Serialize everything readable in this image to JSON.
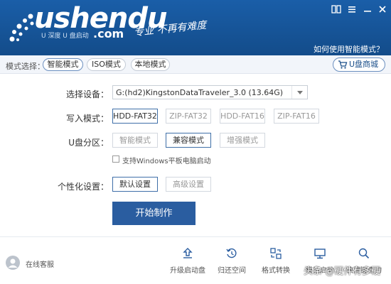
{
  "header": {
    "logo_text": "ushendu",
    "logo_sub": "U 深度 U 盘启动",
    "logo_com": ".com",
    "slogan": "专业 不再有难度",
    "help_link": "如何使用智能模式？",
    "controls": [
      "book-icon",
      "menu-icon",
      "minimize-icon",
      "close-icon"
    ]
  },
  "modebar": {
    "label": "模式选择：",
    "modes": [
      "智能模式",
      "ISO模式",
      "本地模式"
    ],
    "selected_mode": "智能模式",
    "shop": "U盘商城"
  },
  "form": {
    "device_label": "选择设备：",
    "device_value": "G:(hd2)KingstonDataTraveler_3.0 (13.64G)",
    "write_label": "写入模式：",
    "write_options": [
      "HDD-FAT32",
      "ZIP-FAT32",
      "HDD-FAT16",
      "ZIP-FAT16"
    ],
    "write_selected": "HDD-FAT32",
    "partition_label": "U盘分区：",
    "partition_options": [
      "智能模式",
      "兼容模式",
      "增强模式"
    ],
    "partition_selected": "兼容模式",
    "checkbox_label": "支持Windows平板电脑启动",
    "checkbox_checked": false,
    "personal_label": "个性化设置：",
    "personal_options": [
      "默认设置",
      "高级设置"
    ],
    "personal_selected": "默认设置",
    "start_button": "开始制作"
  },
  "footer": {
    "service": "在线客服",
    "tools": [
      {
        "label": "升级启动盘",
        "icon": "upload-icon"
      },
      {
        "label": "归还空间",
        "icon": "restore-icon"
      },
      {
        "label": "格式转换",
        "icon": "convert-icon"
      },
      {
        "label": "模拟启动",
        "icon": "monitor-icon"
      },
      {
        "label": "快捷键查询",
        "icon": "search-icon"
      }
    ]
  },
  "watermark": "头条 @硬件有多硬",
  "colors": {
    "header_blue": "#1a5ea8",
    "accent_blue": "#2a5da0",
    "selected_border": "#3f6fa8"
  }
}
